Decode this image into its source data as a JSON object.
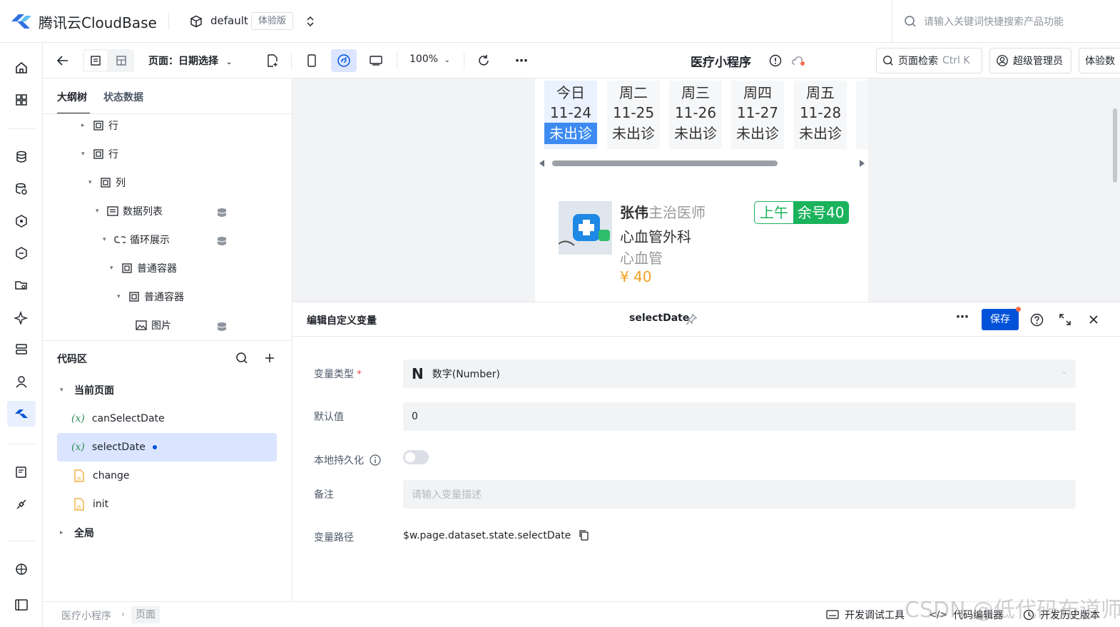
{
  "header": {
    "brand": "腾讯云CloudBase",
    "env_name": "default",
    "env_badge": "体验版",
    "search_placeholder": "请输入关键词快捷搜索产品功能"
  },
  "toolbar": {
    "page_label": "页面：日期选择",
    "zoom": "100%",
    "app_name": "医疗小程序",
    "page_search": "页面检索",
    "shortcut": "Ctrl K",
    "user": "超级管理员",
    "version_button": "体验数"
  },
  "left_panel": {
    "tabs": [
      "大纲树",
      "状态数据"
    ],
    "tree": [
      {
        "label": "行",
        "icon": "container-icon"
      },
      {
        "label": "行",
        "icon": "container-icon"
      },
      {
        "label": "列",
        "icon": "container-icon"
      },
      {
        "label": "数据列表",
        "icon": "list-icon"
      },
      {
        "label": "循环展示",
        "icon": "loop-icon"
      },
      {
        "label": "普通容器",
        "icon": "container-icon"
      },
      {
        "label": "普通容器",
        "icon": "container-icon"
      },
      {
        "label": "图片",
        "icon": "image-icon"
      }
    ],
    "code_title": "代码区",
    "code_sections": {
      "current_page": "当前页面",
      "global": "全局"
    },
    "code_items": [
      {
        "label": "canSelectDate",
        "type": "variable"
      },
      {
        "label": "selectDate",
        "type": "variable"
      },
      {
        "label": "change",
        "type": "js"
      },
      {
        "label": "init",
        "type": "js"
      }
    ]
  },
  "canvas": {
    "days": [
      {
        "weekday": "今日",
        "date": "11-24",
        "status": "未出诊"
      },
      {
        "weekday": "周二",
        "date": "11-25",
        "status": "未出诊"
      },
      {
        "weekday": "周三",
        "date": "11-26",
        "status": "未出诊"
      },
      {
        "weekday": "周四",
        "date": "11-27",
        "status": "未出诊"
      },
      {
        "weekday": "周五",
        "date": "11-28",
        "status": "未出诊"
      }
    ],
    "doctor": {
      "name": "张伟",
      "title": "主治医师",
      "department": "心血管外科",
      "specialty": "心血管",
      "price": "¥ 40",
      "period": "上午",
      "remaining": "余号40"
    }
  },
  "editor": {
    "title": "编辑自定义变量",
    "var_name": "selectDate",
    "save_label": "保存",
    "fields": {
      "type_label": "变量类型",
      "type_value": "数字(Number)",
      "type_icon": "N",
      "default_label": "默认值",
      "default_value": "0",
      "persist_label": "本地持久化",
      "remark_label": "备注",
      "remark_placeholder": "请输入变量描述",
      "path_label": "变量路径",
      "path_value": "$w.page.dataset.state.selectDate"
    }
  },
  "status_bar": {
    "breadcrumb": [
      "医疗小程序",
      "页面"
    ],
    "items": [
      "开发调试工具",
      "代码编辑器",
      "开发历史版本"
    ]
  },
  "watermark": "CSDN @低代码布道师",
  "colors": {
    "primary": "#0052d9",
    "green": "#1ab35c",
    "selected_bg": "#dbe5ff"
  }
}
